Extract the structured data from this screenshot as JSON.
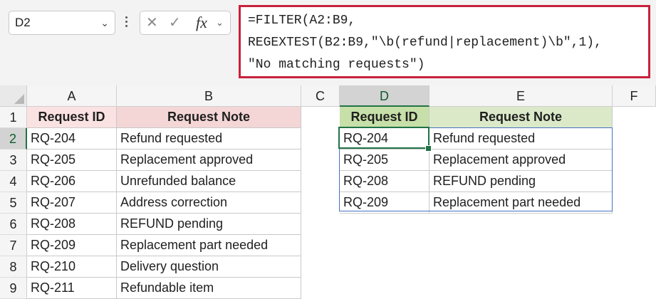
{
  "name_box": {
    "value": "D2",
    "chevron": "chevron-down-icon"
  },
  "formula_controls": {
    "cancel_icon": "✕",
    "enter_icon": "✓",
    "fx_label": "fx",
    "fx_chevron": "⌄"
  },
  "formula": {
    "lines": [
      "=FILTER(A2:B9,",
      "REGEXTEST(B2:B9,\"\\b(refund|replacement)\\b\",1),",
      "\"No matching requests\")"
    ]
  },
  "columns": [
    "A",
    "B",
    "C",
    "D",
    "E",
    "F"
  ],
  "rows": [
    "1",
    "2",
    "3",
    "4",
    "5",
    "6",
    "7",
    "8",
    "9"
  ],
  "source_table": {
    "headers": [
      "Request ID",
      "Request Note"
    ],
    "rows": [
      [
        "RQ-204",
        "Refund requested"
      ],
      [
        "RQ-205",
        "Replacement approved"
      ],
      [
        "RQ-206",
        "Unrefunded balance"
      ],
      [
        "RQ-207",
        "Address correction"
      ],
      [
        "RQ-208",
        "REFUND pending"
      ],
      [
        "RQ-209",
        "Replacement part needed"
      ],
      [
        "RQ-210",
        "Delivery question"
      ],
      [
        "RQ-211",
        "Refundable item"
      ]
    ]
  },
  "result_table": {
    "headers": [
      "Request ID",
      "Request Note"
    ],
    "rows": [
      [
        "RQ-204",
        "Refund requested"
      ],
      [
        "RQ-205",
        "Replacement approved"
      ],
      [
        "RQ-208",
        "REFUND pending"
      ],
      [
        "RQ-209",
        "Replacement part needed"
      ]
    ]
  },
  "colors": {
    "formula_highlight": "#c8223c",
    "selection_green": "#217346",
    "spill_blue": "#4472c4"
  }
}
